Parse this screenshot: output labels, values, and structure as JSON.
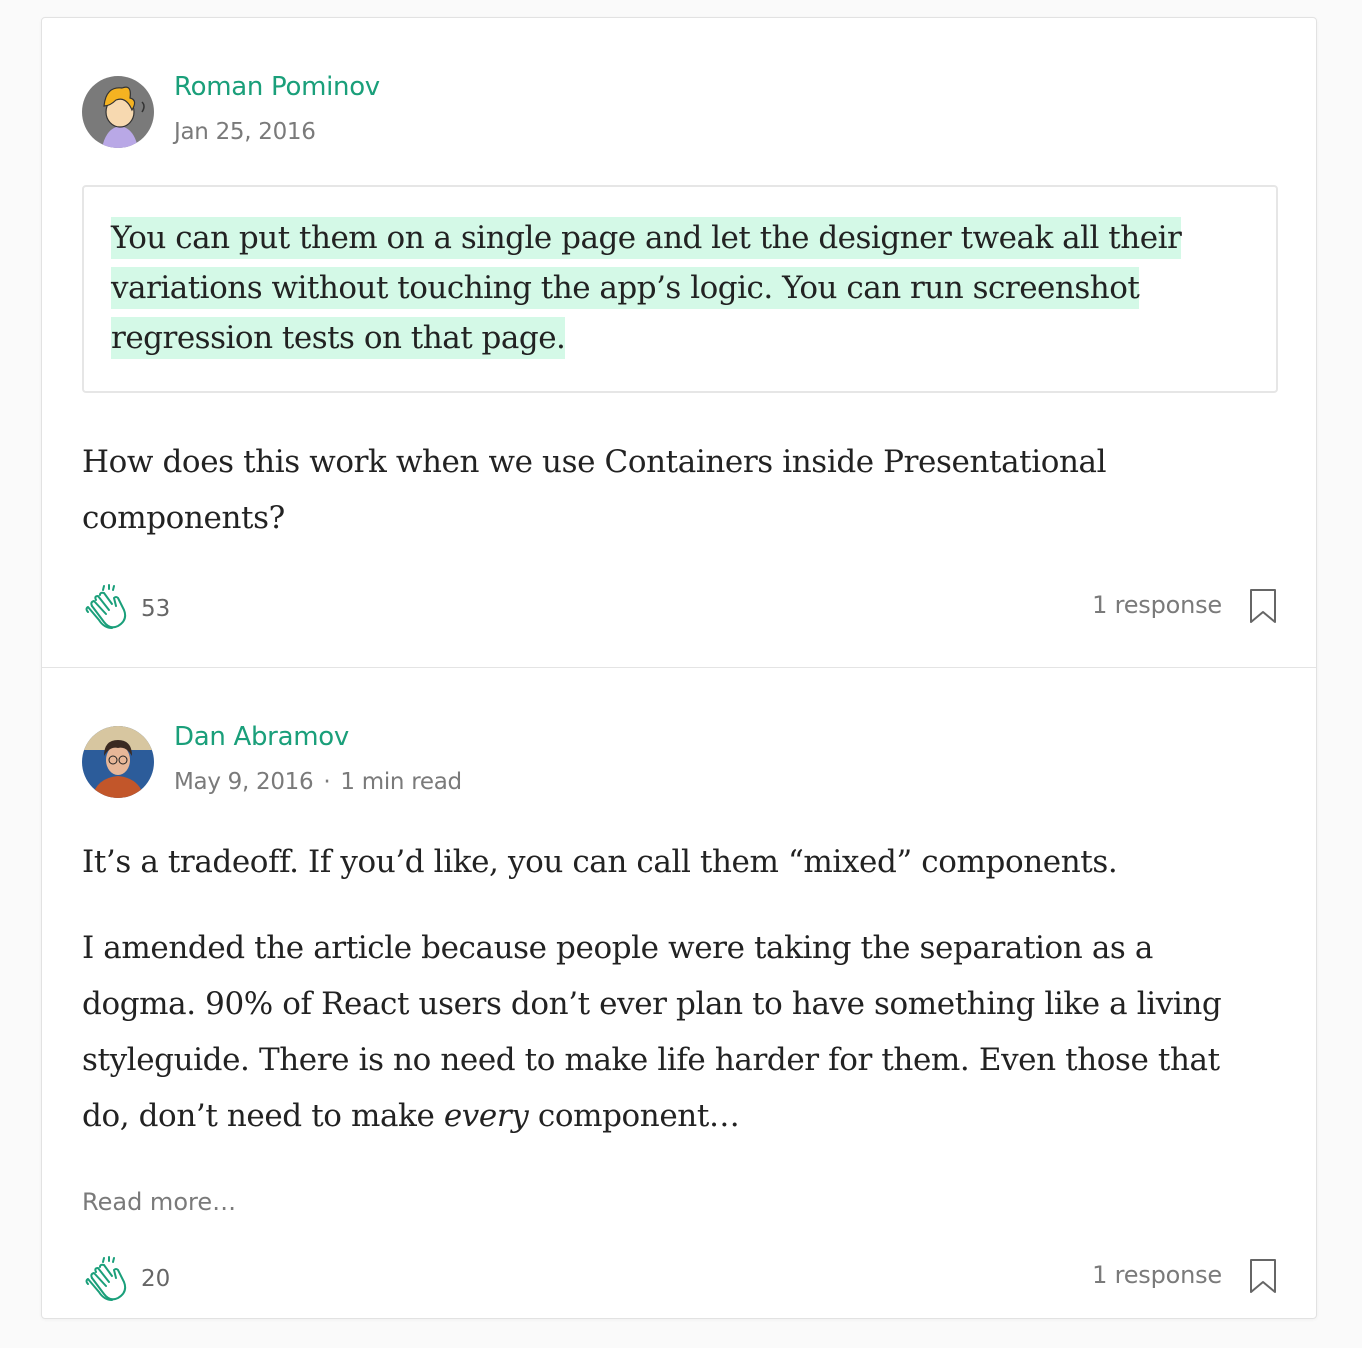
{
  "responses": [
    {
      "author": "Roman Pominov",
      "meta": {
        "date": "Jan 25, 2016"
      },
      "quote": "You can put them on a single page and let the designer tweak all their variations without touching the app’s logic. You can run screenshot regression tests on that page.",
      "body": "How does this work when we use Containers inside Presentational components?",
      "claps": "53",
      "responses_label": "1 response",
      "icons": {
        "avatar": "avatar-cartoon",
        "clap": "clap-icon",
        "bookmark": "bookmark-icon"
      }
    },
    {
      "author": "Dan Abramov",
      "meta": {
        "date": "May 9, 2016",
        "separator": "·",
        "read_time": "1 min read"
      },
      "body_p1": "It’s a tradeoff. If you’d like, you can call them “mixed” components.",
      "body_p2_before": "I amended the article because people were taking the separation as a dogma. 90% of React users don’t ever plan to have something like a living styleguide. There is no need to make life harder for them. Even those that do, don’t need to make ",
      "body_p2_em": "every",
      "body_p2_after": " component…",
      "read_more": "Read more…",
      "claps": "20",
      "responses_label": "1 response",
      "icons": {
        "avatar": "avatar-photo",
        "clap": "clap-icon",
        "bookmark": "bookmark-icon"
      }
    }
  ],
  "colors": {
    "accent": "#1a9f7a",
    "highlight": "#d4f9e7",
    "muted": "#7a7a7a"
  }
}
